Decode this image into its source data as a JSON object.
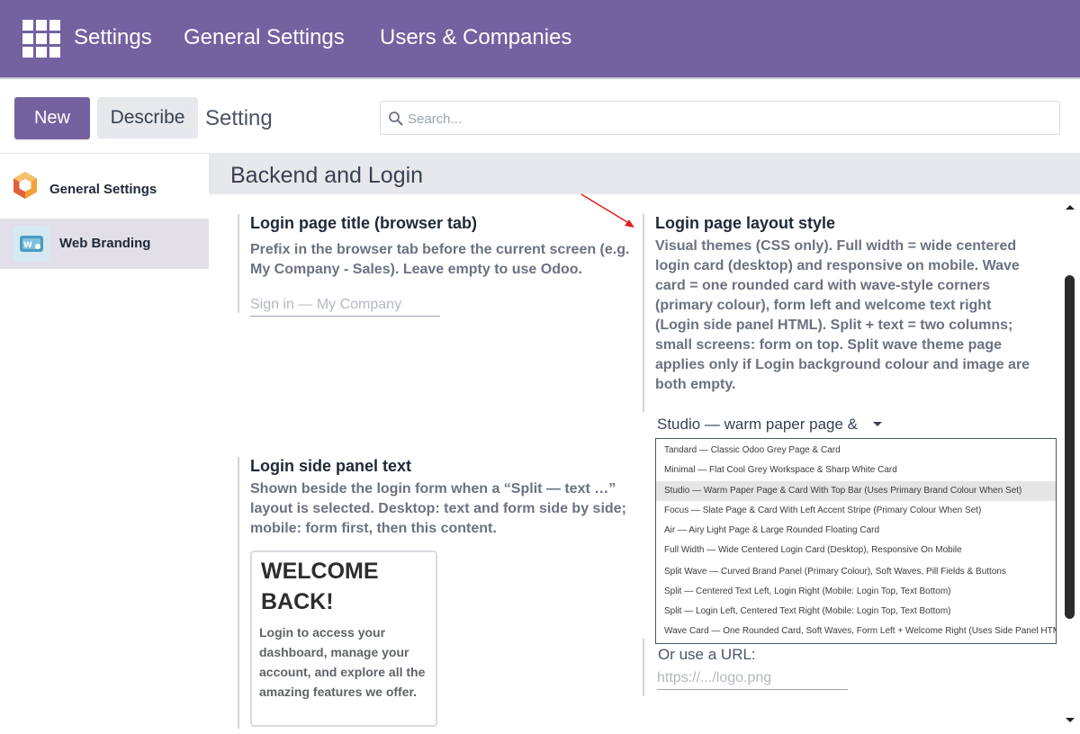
{
  "navbar": {
    "app_name": "Settings",
    "menu": [
      "General Settings",
      "Users & Companies"
    ]
  },
  "control_panel": {
    "new_label": "New",
    "describe_label": "Describe",
    "breadcrumb": "Setting",
    "search_placeholder": "Search..."
  },
  "sidebar": {
    "items": [
      {
        "label": "General Settings",
        "icon": "odoo-logo-icon",
        "active": false
      },
      {
        "label": "Web Branding",
        "icon": "web-branding-icon",
        "active": true
      }
    ]
  },
  "section": {
    "title": "Backend and Login"
  },
  "settings": {
    "login_title": {
      "title": "Login page title (browser tab)",
      "description": "Prefix in the browser tab before the current screen (e.g. My Company - Sales). Leave empty to use Odoo.",
      "placeholder": "Sign in — My Company"
    },
    "layout_style": {
      "title": "Login page layout style",
      "description": "Visual themes (CSS only). Full width = wide centered login card (desktop) and responsive on mobile. Wave card = one rounded card with wave-style corners (primary colour), form left and welcome text right (Login side panel HTML). Split + text = two columns; small screens: form on top. Split wave theme page applies only if Login background colour and image are both empty.",
      "selected_value": "Studio — warm paper page &",
      "options": [
        "Tandard — Classic Odoo Grey Page & Card",
        "Minimal — Flat Cool Grey Workspace & Sharp White Card",
        "Studio — Warm Paper Page & Card With Top Bar (Uses Primary Brand Colour When Set)",
        "Focus — Slate Page & Card With Left Accent Stripe (Primary Colour When Set)",
        "Air — Airy Light Page & Large Rounded Floating Card",
        "Full Width — Wide Centered Login Card (Desktop), Responsive On Mobile",
        "Split Wave — Curved Brand Panel (Primary Colour), Soft Waves, Pill Fields & Buttons",
        "Split — Centered Text Left, Login Right (Mobile: Login Top, Text Bottom)",
        "Split — Login Left, Centered Text Right (Mobile: Login Top, Text Bottom)",
        "Wave Card — One Rounded Card, Soft Waves, Form Left + Welcome Right (Uses Side Panel HTML)"
      ],
      "selected_index": 2,
      "url_label": "Or use a URL:",
      "url_placeholder": "https://.../logo.png"
    },
    "side_panel": {
      "title": "Login side panel text",
      "description": "Shown beside the login form when a “Split — text …” layout is selected. Desktop: text and form side by side; mobile: form first, then this content.",
      "preview_heading": "WELCOME BACK!",
      "preview_text": "Login to access your dashboard, manage your account, and explore all the amazing features we offer."
    }
  },
  "colors": {
    "brand": "#7461a0",
    "annotation_arrow": "#e02020"
  }
}
